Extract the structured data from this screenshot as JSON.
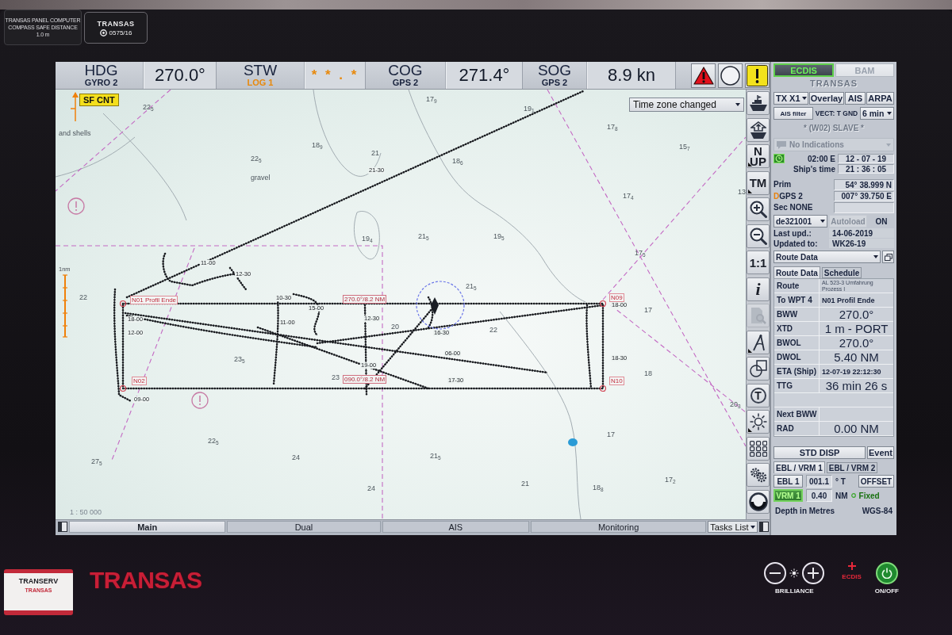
{
  "stickers": {
    "compass": [
      "TRANSAS PANEL COMPUTER",
      "COMPASS SAFE DISTANCE",
      "1.0 m"
    ],
    "seal": {
      "brand": "TRANSAS",
      "number": "0575/16"
    }
  },
  "top_bar": {
    "sensors": [
      {
        "label": "HDG",
        "source": "GYRO 2",
        "value": "270.0°",
        "valid": true
      },
      {
        "label": "STW",
        "source": "LOG 1",
        "value": "* * . *",
        "valid": false
      },
      {
        "label": "COG",
        "source": "GPS 2",
        "value": "271.4°",
        "valid": true
      },
      {
        "label": "SOG",
        "source": "GPS 2",
        "value": "8.9 kn",
        "valid": true
      }
    ],
    "alarms": [
      {
        "kind": "alarm"
      },
      {
        "kind": "idle"
      },
      {
        "kind": "warning"
      }
    ]
  },
  "map": {
    "mode_flag": "SF CNT",
    "notice": "Time zone changed",
    "soundings": [
      "22$_{5}$",
      "17$_{9}$",
      "19$_{1}$",
      "17$_{8}$",
      "15$_{7}$",
      "18$_{9}$",
      "21",
      "18$_{6}$",
      "22$_{5}$",
      "17$_{4}$",
      "13",
      "19$_{4}$",
      "21$_{5}$",
      "19$_{5}$",
      "17$_{5}$",
      "21$_{5}$",
      "17",
      "20",
      "22",
      "22",
      "23$_{5}$",
      "23",
      "18",
      "20$_{3}$",
      "22$_{5}$",
      "24",
      "21$_{5}$",
      "17",
      "27$_{5}$",
      "24",
      "21",
      "18$_{8}$",
      "17$_{2}$"
    ],
    "seabed_notes": [
      "and shells",
      "gravel"
    ],
    "waypoints": [
      "N01 Profil Ende",
      "N02",
      "N09",
      "N10"
    ],
    "leg_labels": [
      "270.0°/8.2 NM",
      "090.0°/8.2 NM"
    ],
    "track_times": [
      "21-30",
      "11-00",
      "12-30",
      "10-30",
      "15-00",
      "11-00",
      "18-00",
      "12-00",
      "09-00",
      "12-30",
      "16-30",
      "18-00",
      "06-00",
      "19-00",
      "17-30",
      "18-30"
    ],
    "distance_mark": "1nm",
    "scale": "1 : 50 000"
  },
  "toolbar": [
    {
      "kind": "icon",
      "menu": false,
      "disabled": false
    },
    {
      "kind": "icon",
      "menu": false,
      "disabled": false
    },
    {
      "kind": "text",
      "label": "N UP",
      "menu": true,
      "disabled": false
    },
    {
      "kind": "text",
      "label": "TM",
      "menu": true,
      "disabled": false
    },
    {
      "kind": "icon",
      "menu": false,
      "disabled": false
    },
    {
      "kind": "icon",
      "menu": false,
      "disabled": false
    },
    {
      "kind": "text",
      "label": "1:1",
      "menu": false,
      "disabled": false
    },
    {
      "kind": "glyph",
      "label": "i",
      "menu": false,
      "disabled": false
    },
    {
      "kind": "icon",
      "menu": false,
      "disabled": true
    },
    {
      "kind": "icon",
      "menu": true,
      "disabled": false
    },
    {
      "kind": "icon",
      "menu": false,
      "disabled": false
    },
    {
      "kind": "circled",
      "label": "T",
      "menu": false,
      "disabled": false
    },
    {
      "kind": "icon",
      "menu": true,
      "disabled": false
    },
    {
      "kind": "icon",
      "menu": false,
      "disabled": false
    },
    {
      "kind": "icon",
      "menu": false,
      "disabled": false
    },
    {
      "kind": "icon",
      "menu": false,
      "disabled": false
    }
  ],
  "bottom_bar": {
    "tabs": [
      {
        "label": "Main",
        "selected": true
      },
      {
        "label": "Dual",
        "selected": false
      },
      {
        "label": "AIS",
        "selected": false
      },
      {
        "label": "Monitoring",
        "selected": false
      }
    ],
    "tasks": "Tasks List"
  },
  "panel": {
    "tabs": [
      {
        "label": "ECDIS",
        "selected": true
      },
      {
        "label": "BAM",
        "selected": false
      }
    ],
    "logo": "TRANSAS",
    "display_buttons": [
      {
        "label": "TX X1",
        "kind": "dropdown"
      },
      {
        "label": "Overlay",
        "kind": "button"
      },
      {
        "label": "AIS",
        "kind": "button"
      },
      {
        "label": "ARPA",
        "kind": "button"
      }
    ],
    "ais_filter": "AIS filter",
    "vector_mode": "VECT: T GND",
    "vector_time": "6 min",
    "station": "* (W02) SLAVE *",
    "indications": {
      "value": "No Indications",
      "disabled": true
    },
    "time": {
      "zone": "02:00 E",
      "date": "12 - 07 - 19",
      "label": "Ship's time",
      "clock": "21 : 36 : 05"
    },
    "positions": [
      {
        "label": "Prim",
        "value": "54° 38.999 N",
        "differential": false
      },
      {
        "label": "DGPS 2",
        "value": "007° 39.750 E",
        "differential": true
      }
    ],
    "secondary": "Sec NONE",
    "database": {
      "cell": "de321001",
      "autoload": {
        "label": "Autoload",
        "disabled": true
      },
      "status": "ON",
      "rows": [
        {
          "label": "Last upd.:",
          "value": "14-06-2019"
        },
        {
          "label": "Updated to:",
          "value": "WK26-19"
        }
      ]
    },
    "view_select": "Route Data",
    "route_tabs": [
      {
        "label": "Route Data",
        "selected": true
      },
      {
        "label": "Schedule",
        "selected": false
      }
    ],
    "route_rows": [
      {
        "kind": "note",
        "label": "Route",
        "value": "AL 523-3 Umfahrung Prozess I"
      },
      {
        "kind": "text",
        "label": "To WPT 4",
        "value": "N01 Profil Ende"
      },
      {
        "kind": "reading",
        "label": "BWW",
        "value": "270.0°"
      },
      {
        "kind": "reading",
        "label": "XTD",
        "value": "1 m - PORT"
      },
      {
        "kind": "reading",
        "label": "BWOL",
        "value": "270.0°"
      },
      {
        "kind": "reading",
        "label": "DWOL",
        "value": "5.40 NM"
      },
      {
        "kind": "text",
        "label": "ETA (Ship)",
        "value": "12-07-19 22:12:30"
      },
      {
        "kind": "reading",
        "label": "TTG",
        "value": "36 min 26 s"
      },
      {
        "kind": "blank"
      },
      {
        "kind": "reading",
        "label": "Next BWW"
      },
      {
        "kind": "reading",
        "label": "RAD",
        "value": "0.00 NM"
      }
    ],
    "display_mode": "STD DISP",
    "event": "Event",
    "ebl_tabs": [
      {
        "label": "EBL / VRM 1",
        "selected": true
      },
      {
        "label": "EBL / VRM 2",
        "selected": false
      }
    ],
    "ebl": {
      "button": "EBL 1",
      "active": false,
      "value": "001.1",
      "unit": "° T",
      "offset": "OFFSET"
    },
    "vrm": {
      "button": "VRM 1",
      "active": true,
      "value": "0.40",
      "unit": "NM",
      "mode": "Fixed",
      "fixed": true
    },
    "footer": {
      "depth": "Depth in Metres",
      "datum": "WGS-84"
    }
  },
  "bezel": {
    "service_sticker": {
      "title": "TRANSERV",
      "brand": "TRANSAS"
    },
    "logo": "TRANSAS",
    "brilliance": "BRILLIANCE",
    "alarm_label": "ECDIS",
    "power": "ON/OFF"
  }
}
